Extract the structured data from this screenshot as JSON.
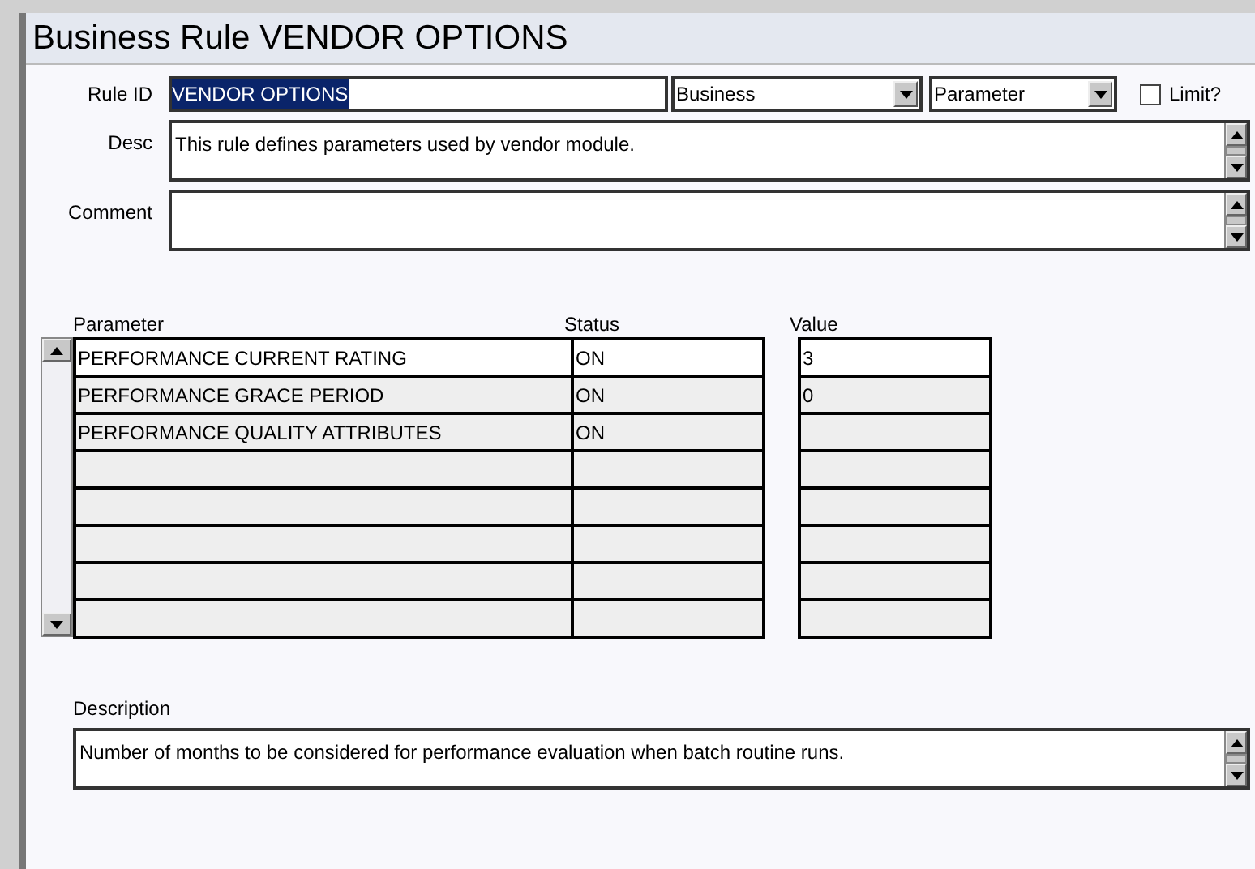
{
  "window": {
    "title": "Business Rule VENDOR OPTIONS"
  },
  "form": {
    "rule_id_label": "Rule ID",
    "rule_id": "VENDOR OPTIONS",
    "rule_id_selected": true,
    "type": "Business",
    "category": "Parameter",
    "limit_label": "Limit?",
    "limit_checked": false,
    "desc_label": "Desc",
    "desc": "This rule defines parameters used by vendor module.",
    "comment_label": "Comment"
  },
  "table": {
    "columns": [
      "Parameter",
      "Status",
      "Value"
    ],
    "rows": [
      {
        "parameter": "PERFORMANCE CURRENT RATING",
        "status": "ON",
        "value": "3",
        "selected": true
      },
      {
        "parameter": "PERFORMANCE GRACE PERIOD",
        "status": "ON",
        "value": "0",
        "selected": false
      },
      {
        "parameter": "PERFORMANCE QUALITY ATTRIBUTES",
        "status": "ON",
        "value": "",
        "selected": false
      },
      {
        "parameter": "",
        "status": "",
        "value": "",
        "selected": false
      },
      {
        "parameter": "",
        "status": "",
        "value": "",
        "selected": false
      },
      {
        "parameter": "",
        "status": "",
        "value": "",
        "selected": false
      },
      {
        "parameter": "",
        "status": "",
        "value": "",
        "selected": false
      },
      {
        "parameter": "",
        "status": "",
        "value": "",
        "selected": false
      }
    ]
  },
  "description": {
    "label": "Description",
    "text": "Number of months to be considered for performance evaluation when batch routine runs."
  }
}
